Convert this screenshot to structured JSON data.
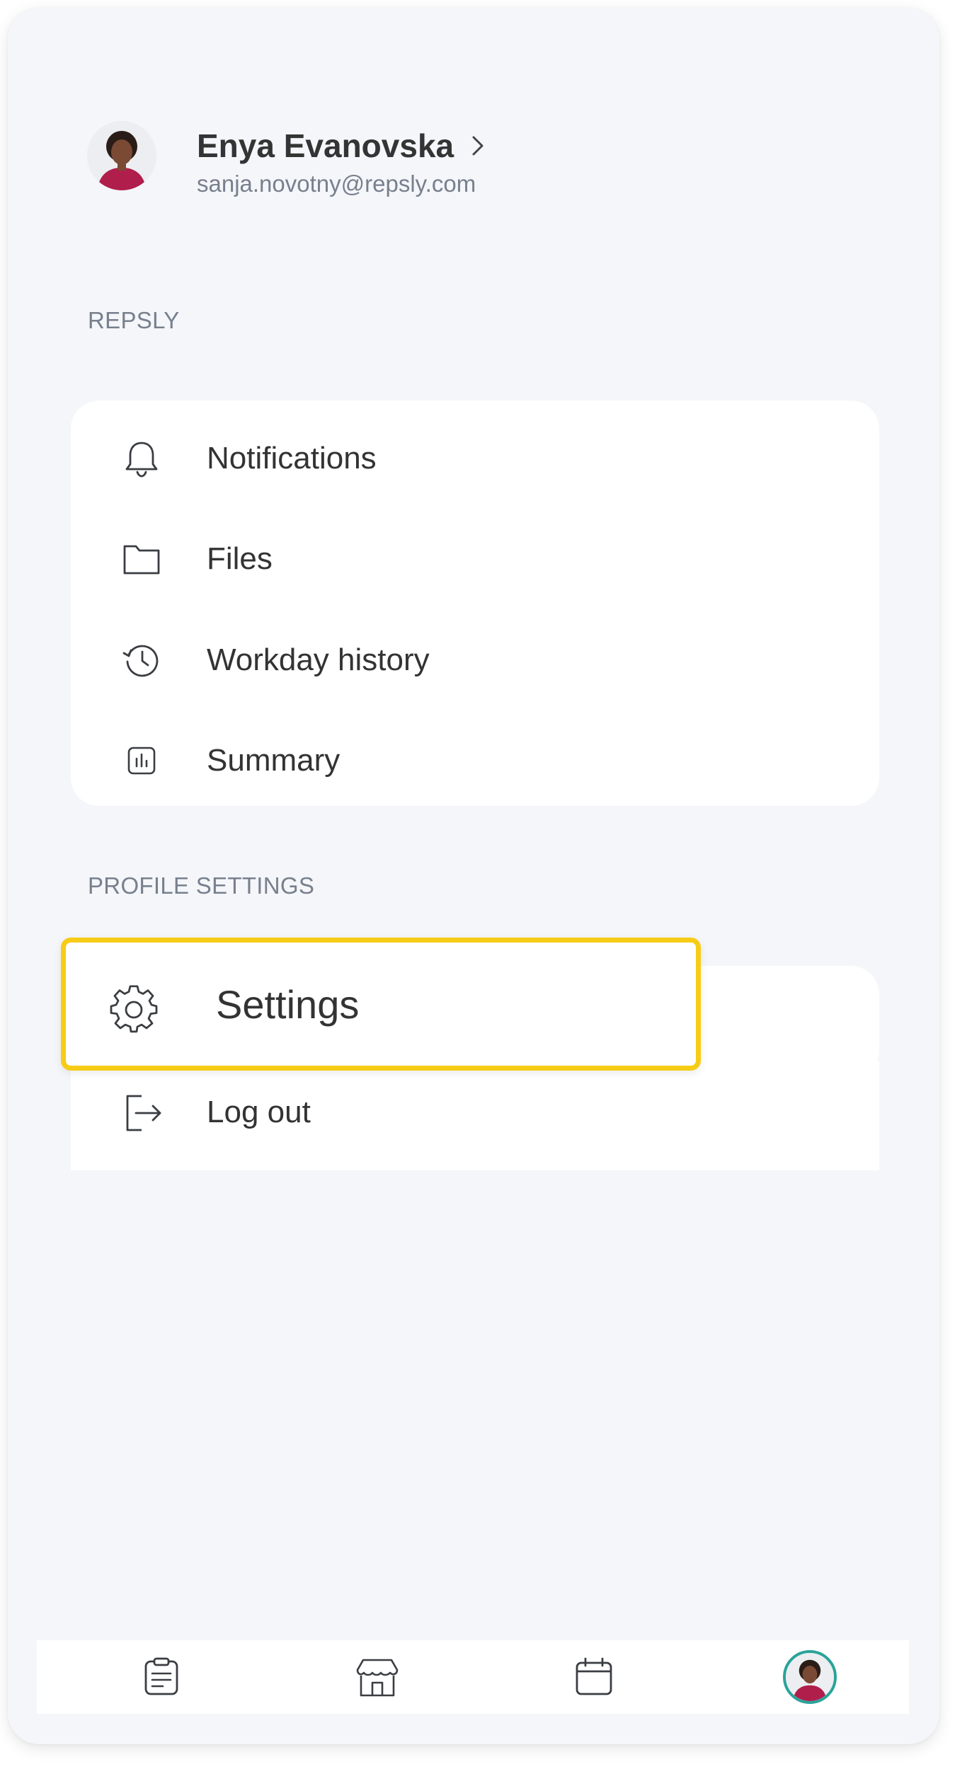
{
  "profile": {
    "name": "Enya Evanovska",
    "email": "sanja.novotny@repsly.com",
    "avatar_icon": "user-avatar-photo"
  },
  "sections": {
    "repsly_label": "REPSLY",
    "profile_settings_label": "PROFILE SETTINGS"
  },
  "repsly_menu": [
    {
      "label": "Notifications",
      "icon": "bell-icon"
    },
    {
      "label": "Files",
      "icon": "folder-icon"
    },
    {
      "label": "Workday history",
      "icon": "history-clock-icon"
    },
    {
      "label": "Summary",
      "icon": "bar-chart-icon"
    }
  ],
  "profile_menu": [
    {
      "label": "Settings",
      "icon": "gear-icon",
      "highlighted": true
    },
    {
      "label": "Log out",
      "icon": "logout-icon"
    }
  ],
  "tabbar": [
    {
      "name": "tasks",
      "icon": "clipboard-icon"
    },
    {
      "name": "places",
      "icon": "store-icon"
    },
    {
      "name": "calendar",
      "icon": "calendar-icon"
    },
    {
      "name": "profile",
      "icon": "avatar-icon",
      "active": true
    }
  ],
  "colors": {
    "background": "#f5f6fa",
    "card": "#ffffff",
    "highlight_border": "#f6cc16",
    "muted_text": "#77808d",
    "active_tab_ring": "#2aa39a"
  }
}
